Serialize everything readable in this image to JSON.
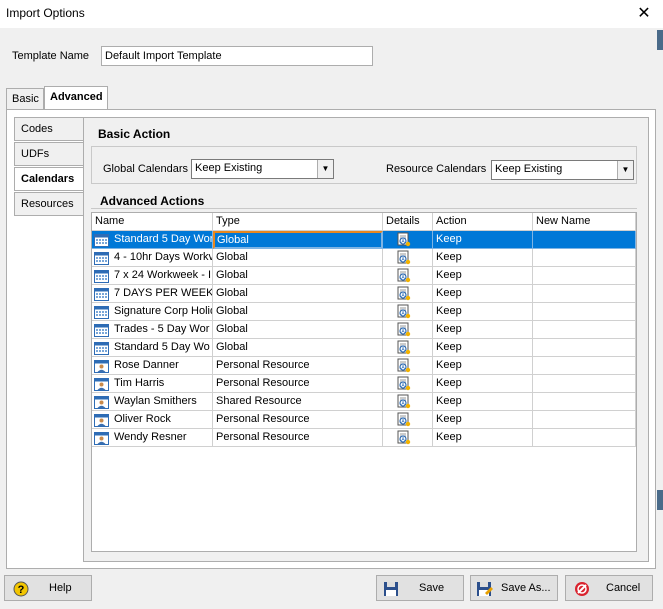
{
  "window": {
    "title": "Import Options",
    "close_glyph": "✕"
  },
  "template": {
    "label": "Template Name",
    "value": "Default Import Template"
  },
  "tabs": [
    {
      "label": "Basic"
    },
    {
      "label": "Advanced"
    }
  ],
  "side_tabs": [
    {
      "label": "Codes"
    },
    {
      "label": "UDFs"
    },
    {
      "label": "Calendars"
    },
    {
      "label": "Resources"
    }
  ],
  "basic_action": {
    "title": "Basic Action",
    "global_calendars_label": "Global Calendars",
    "global_calendars_value": "Keep Existing",
    "resource_calendars_label": "Resource Calendars",
    "resource_calendars_value": "Keep Existing"
  },
  "advanced_actions": {
    "title": "Advanced Actions",
    "columns": [
      "Name",
      "Type",
      "Details",
      "Action",
      "New Name"
    ],
    "rows": [
      {
        "name": "Standard 5 Day Wor",
        "type": "Global",
        "action": "Keep",
        "icon": "calendar-icon"
      },
      {
        "name": "4 - 10hr Days Workv",
        "type": "Global",
        "action": "Keep",
        "icon": "calendar-icon"
      },
      {
        "name": "7 x 24 Workweek - I",
        "type": "Global",
        "action": "Keep",
        "icon": "calendar-icon"
      },
      {
        "name": "7 DAYS PER WEEK '",
        "type": "Global",
        "action": "Keep",
        "icon": "calendar-icon"
      },
      {
        "name": "Signature Corp Holid",
        "type": "Global",
        "action": "Keep",
        "icon": "calendar-icon"
      },
      {
        "name": "Trades -  5 Day Wor",
        "type": "Global",
        "action": "Keep",
        "icon": "calendar-icon"
      },
      {
        "name": " Standard 5 Day Wo",
        "type": "Global",
        "action": "Keep",
        "icon": "calendar-icon"
      },
      {
        "name": "Rose Danner",
        "type": "Personal Resource",
        "action": "Keep",
        "icon": "resource-calendar-icon"
      },
      {
        "name": "Tim Harris",
        "type": "Personal Resource",
        "action": "Keep",
        "icon": "resource-calendar-icon"
      },
      {
        "name": "Waylan Smithers",
        "type": "Shared Resource",
        "action": "Keep",
        "icon": "resource-calendar-icon"
      },
      {
        "name": "Oliver Rock",
        "type": "Personal Resource",
        "action": "Keep",
        "icon": "resource-calendar-icon"
      },
      {
        "name": "Wendy Resner",
        "type": "Personal Resource",
        "action": "Keep",
        "icon": "resource-calendar-icon"
      }
    ]
  },
  "buttons": {
    "help": "Help",
    "save": "Save",
    "save_as": "Save As...",
    "cancel": "Cancel"
  },
  "colors": {
    "selection": "#0078d7",
    "focus_border": "#e8871e",
    "cancel_red": "#d9232e",
    "help_yellow": "#f2c500"
  }
}
